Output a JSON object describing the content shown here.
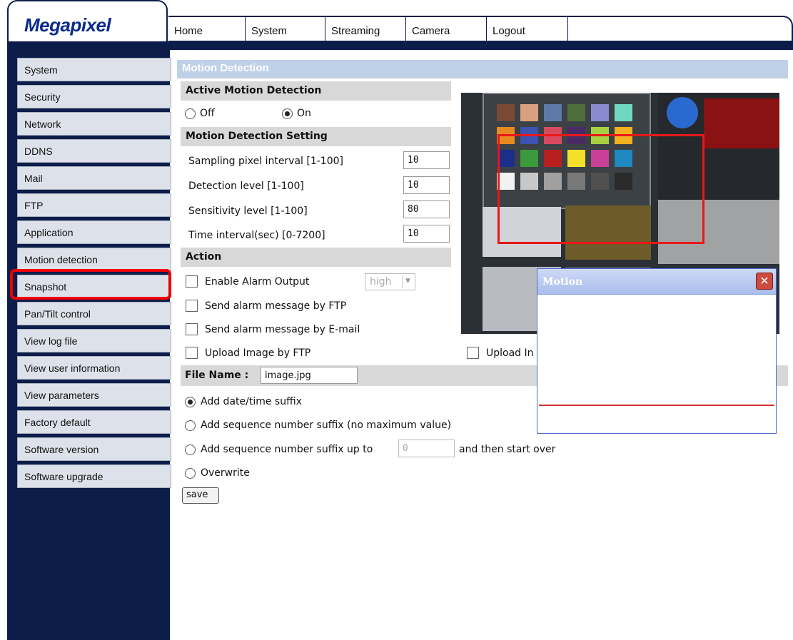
{
  "brand": {
    "logo": "Megapixel"
  },
  "tabs": [
    "Home",
    "System",
    "Streaming",
    "Camera",
    "Logout"
  ],
  "sidebar": {
    "items": [
      {
        "label": "System"
      },
      {
        "label": "Security"
      },
      {
        "label": "Network"
      },
      {
        "label": "DDNS"
      },
      {
        "label": "Mail"
      },
      {
        "label": "FTP"
      },
      {
        "label": "Application"
      },
      {
        "label": "Motion detection"
      },
      {
        "label": "Snapshot"
      },
      {
        "label": "Pan/Tilt control"
      },
      {
        "label": "View log file"
      },
      {
        "label": "View user information"
      },
      {
        "label": "View parameters"
      },
      {
        "label": "Factory default"
      },
      {
        "label": "Software version"
      },
      {
        "label": "Software upgrade"
      }
    ],
    "highlighted": "Snapshot"
  },
  "page": {
    "title": "Motion Detection"
  },
  "active_motion": {
    "header": "Active Motion Detection",
    "off_label": "Off",
    "on_label": "On",
    "selected": "On"
  },
  "settings": {
    "header": "Motion Detection Setting",
    "fields": [
      {
        "label": "Sampling pixel interval [1-100]",
        "value": "10"
      },
      {
        "label": "Detection level [1-100]",
        "value": "10"
      },
      {
        "label": "Sensitivity level [1-100]",
        "value": "80"
      },
      {
        "label": "Time interval(sec) [0-7200]",
        "value": "10"
      }
    ]
  },
  "action": {
    "header": "Action",
    "enable_alarm_label": "Enable Alarm Output",
    "alarm_level": "high",
    "ftp_message_label": "Send alarm message by FTP",
    "email_message_label": "Send alarm message by E-mail",
    "upload_ftp_label": "Upload Image by FTP",
    "upload_partial_label": "Upload In"
  },
  "file": {
    "label": "File Name :",
    "name": "image.jpg",
    "options": [
      "Add date/time suffix",
      "Add sequence number suffix (no maximum value)",
      "Add sequence number suffix up to",
      "Overwrite"
    ],
    "selected": "Add date/time suffix",
    "sequence_max": "0",
    "then_label": "and then start over"
  },
  "save_label": "save",
  "popup": {
    "title": "Motion",
    "close": "✕"
  },
  "colors": {
    "nav": "#0d1d4a",
    "accent": "#0a2a8c",
    "highlight": "#ee0000",
    "section": "#bed1e8"
  }
}
